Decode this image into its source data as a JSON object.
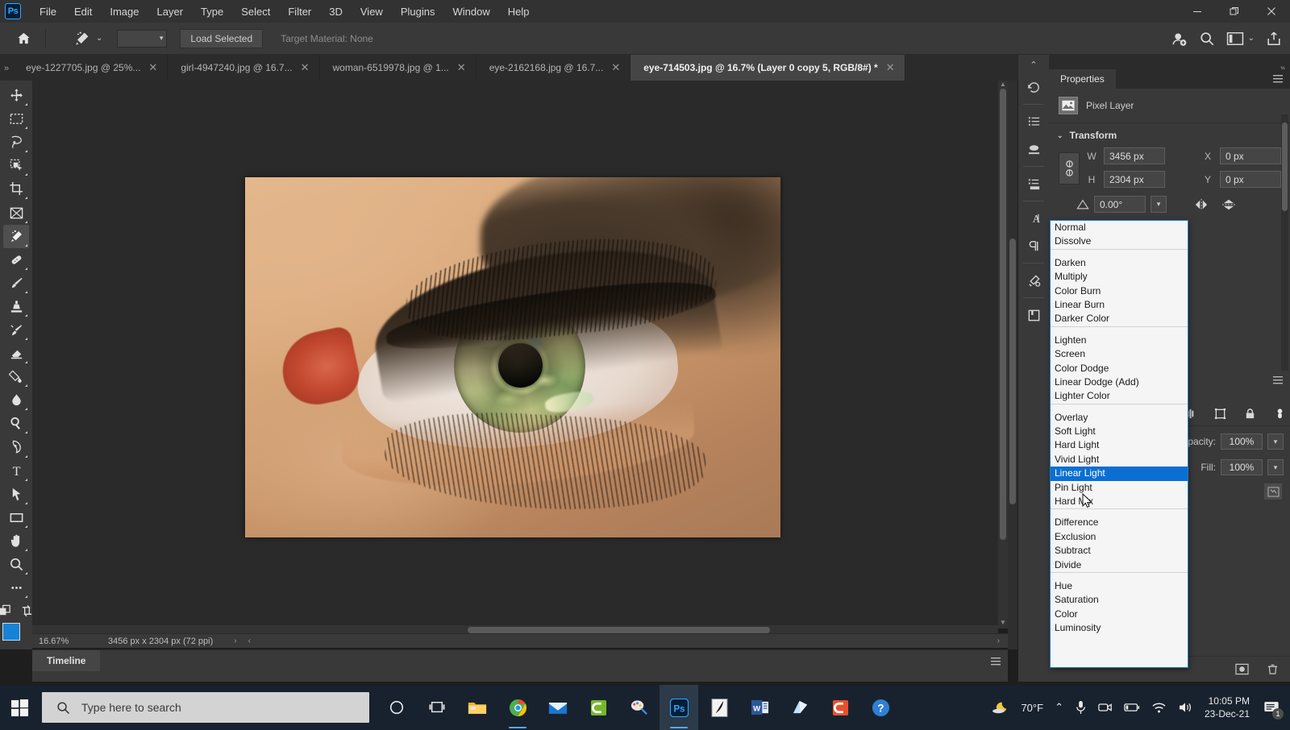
{
  "app": {
    "name": "Adobe Photoshop",
    "logo_text": "Ps"
  },
  "menubar": {
    "items": [
      {
        "label": "File"
      },
      {
        "label": "Edit"
      },
      {
        "label": "Image"
      },
      {
        "label": "Layer"
      },
      {
        "label": "Type"
      },
      {
        "label": "Select"
      },
      {
        "label": "Filter"
      },
      {
        "label": "3D"
      },
      {
        "label": "View"
      },
      {
        "label": "Plugins"
      },
      {
        "label": "Window"
      },
      {
        "label": "Help"
      }
    ],
    "window_controls": {
      "minimize": "—",
      "restore": "❐",
      "close": "✕"
    }
  },
  "optionsbar": {
    "home_icon": "home-icon",
    "tool_icon": "magic-wand-eyedropper-icon",
    "tool_preset_caret": "⌄",
    "load_selected_label": "Load Selected",
    "target_material_label": "Target Material: None",
    "right_icons": [
      "share-user-icon",
      "search-icon",
      "workspace-icon",
      "chevron-down-icon",
      "export-icon"
    ]
  },
  "tabs": {
    "overflow_chevron": "»",
    "items": [
      {
        "label": "eye-1227705.jpg @ 25%...",
        "active": false,
        "close": "✕"
      },
      {
        "label": "girl-4947240.jpg @ 16.7...",
        "active": false,
        "close": "✕"
      },
      {
        "label": "woman-6519978.jpg @ 1...",
        "active": false,
        "close": "✕"
      },
      {
        "label": "eye-2162168.jpg @ 16.7...",
        "active": false,
        "close": "✕"
      },
      {
        "label": "eye-714503.jpg @ 16.7% (Layer 0 copy 5, RGB/8#) *",
        "active": true,
        "close": "✕"
      }
    ],
    "right_chevron": "»"
  },
  "toolbar": {
    "tools": [
      {
        "name": "move-tool",
        "selected": false
      },
      {
        "name": "rectangular-marquee-tool",
        "selected": false
      },
      {
        "name": "lasso-tool",
        "selected": false
      },
      {
        "name": "object-selection-tool",
        "selected": false
      },
      {
        "name": "crop-tool",
        "selected": false
      },
      {
        "name": "frame-tool",
        "selected": false
      },
      {
        "name": "eyedropper-tool",
        "selected": true
      },
      {
        "name": "spot-healing-brush-tool",
        "selected": false
      },
      {
        "name": "brush-tool",
        "selected": false
      },
      {
        "name": "clone-stamp-tool",
        "selected": false
      },
      {
        "name": "history-brush-tool",
        "selected": false
      },
      {
        "name": "eraser-tool",
        "selected": false
      },
      {
        "name": "gradient-tool",
        "selected": false
      },
      {
        "name": "blur-tool",
        "selected": false
      },
      {
        "name": "dodge-tool",
        "selected": false
      },
      {
        "name": "pen-tool",
        "selected": false
      },
      {
        "name": "type-tool",
        "selected": false
      },
      {
        "name": "path-selection-tool",
        "selected": false
      },
      {
        "name": "rectangle-tool",
        "selected": false
      },
      {
        "name": "hand-tool",
        "selected": false
      },
      {
        "name": "zoom-tool",
        "selected": false
      },
      {
        "name": "edit-toolbar-tool",
        "selected": false
      }
    ],
    "quickmask_name": "quick-mask-icon",
    "screenmode_name": "screen-mode-icon",
    "foreground_color": "#1683d8",
    "background_color": "#3b3b3b"
  },
  "statusbar": {
    "zoom": "16.67%",
    "dimensions": "3456 px x 2304 px (72 ppi)",
    "arrow_right": "›",
    "arrow_left": "‹"
  },
  "timeline": {
    "tab_label": "Timeline",
    "menu_icon": "panel-menu-icon"
  },
  "right_rail": {
    "collapse_chevron": "⌃",
    "icons": [
      {
        "name": "history-panel-icon"
      },
      {
        "name": "actions-panel-icon"
      },
      {
        "name": "brush-settings-icon"
      },
      {
        "name": "adjustments-panel-icon"
      },
      {
        "name": "character-panel-icon"
      },
      {
        "name": "paragraph-panel-icon"
      },
      {
        "name": "tool-presets-icon"
      },
      {
        "name": "libraries-panel-icon"
      }
    ]
  },
  "properties": {
    "tab_label": "Properties",
    "menu_icon": "panel-menu-icon",
    "layer_kind": "Pixel Layer",
    "layer_thumb_icon": "image-thumbnail-icon",
    "transform": {
      "section_label": "Transform",
      "caret": "⌄",
      "w_label": "W",
      "w_value": "3456 px",
      "h_label": "H",
      "h_value": "2304 px",
      "x_label": "X",
      "x_value": "0 px",
      "y_label": "Y",
      "y_value": "0 px",
      "angle_icon": "angle-icon",
      "angle_value": "0.00°",
      "angle_caret": "⌄",
      "flip_horizontal_icon": "flip-horizontal-icon",
      "flip_vertical_icon": "flip-vertical-icon",
      "link_icon": "link-constrain-icon"
    }
  },
  "layers": {
    "opacity_label": "Opacity:",
    "opacity_value": "100%",
    "fill_label": "Fill:",
    "fill_value": "100%",
    "caret": "⌄",
    "lock_icons": [
      "lock-transparent-pixels-icon",
      "lock-image-pixels-icon",
      "lock-position-icon",
      "lock-artboard-icon",
      "lock-all-icon"
    ],
    "footer_icons": [
      "link-layers-icon",
      "layer-style-icon",
      "add-mask-icon",
      "adjustment-layer-icon",
      "new-group-icon",
      "new-layer-icon",
      "delete-layer-icon"
    ]
  },
  "blend_dropdown": {
    "name": "blend-mode-dropdown",
    "selected": "Linear Light",
    "groups": [
      {
        "items": [
          "Normal",
          "Dissolve"
        ]
      },
      {
        "items": [
          "Darken",
          "Multiply",
          "Color Burn",
          "Linear Burn",
          "Darker Color"
        ]
      },
      {
        "items": [
          "Lighten",
          "Screen",
          "Color Dodge",
          "Linear Dodge (Add)",
          "Lighter Color"
        ]
      },
      {
        "items": [
          "Overlay",
          "Soft Light",
          "Hard Light",
          "Vivid Light",
          "Linear Light",
          "Pin Light",
          "Hard Mix"
        ]
      },
      {
        "items": [
          "Difference",
          "Exclusion",
          "Subtract",
          "Divide"
        ]
      },
      {
        "items": [
          "Hue",
          "Saturation",
          "Color",
          "Luminosity"
        ]
      }
    ]
  },
  "taskbar": {
    "search_placeholder": "Type here to search",
    "search_icon": "search-icon",
    "start_icon": "windows-start-icon",
    "items": [
      {
        "name": "cortana-icon"
      },
      {
        "name": "task-view-icon"
      },
      {
        "name": "file-explorer-icon"
      },
      {
        "name": "google-chrome-icon"
      },
      {
        "name": "mail-icon"
      },
      {
        "name": "camtasia-icon"
      },
      {
        "name": "paint-icon"
      },
      {
        "name": "photoshop-icon"
      },
      {
        "name": "dark-app-icon"
      },
      {
        "name": "word-icon"
      },
      {
        "name": "onedrive-app-icon"
      },
      {
        "name": "camtasia-recorder-icon"
      }
    ],
    "tray": {
      "weather_icon": "moon-weather-icon",
      "temperature": "70°F",
      "chevron_up": "⌃",
      "icons": [
        "microphone-icon",
        "camera-icon",
        "battery-icon",
        "wifi-icon",
        "volume-icon"
      ],
      "time": "10:05 PM",
      "date": "23-Dec-21",
      "notification_icon": "notifications-icon",
      "notification_count": "1"
    }
  }
}
